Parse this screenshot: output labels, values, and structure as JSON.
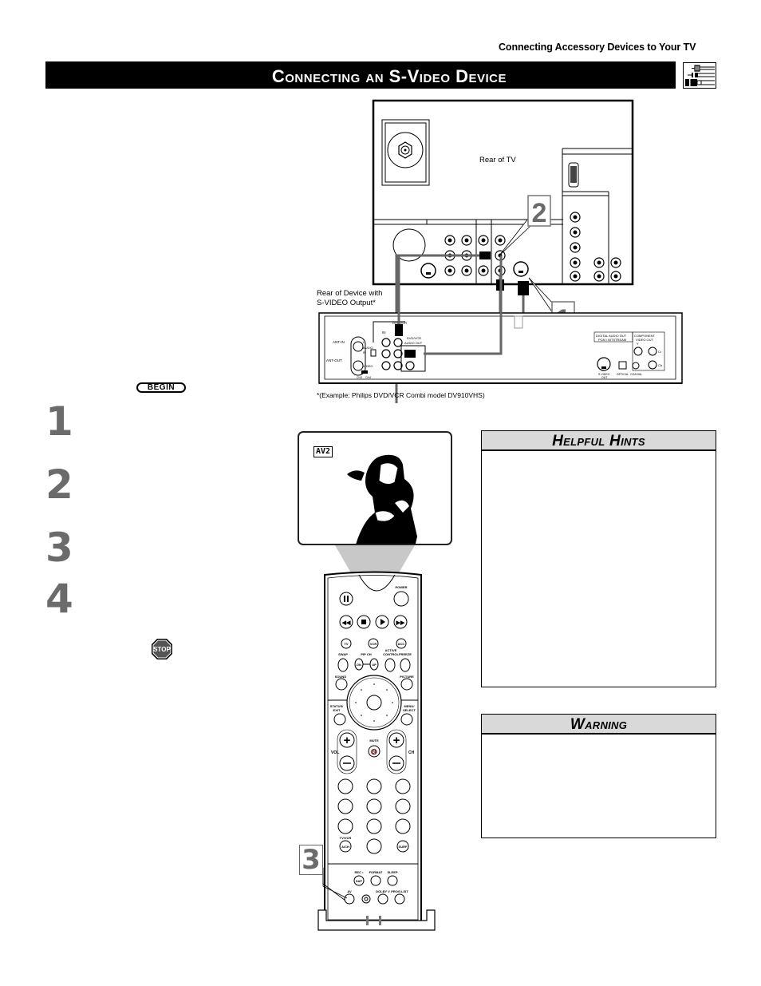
{
  "page": {
    "section_header": "Connecting Accessory Devices to Your TV",
    "title": "Connecting an S-Video Device"
  },
  "icons": {
    "cable_icon": "cable-connectors-icon",
    "begin": "begin-badge",
    "stop": "stop-sign-icon"
  },
  "diagram": {
    "tv_label": "Rear of TV",
    "device_label_line1": "Rear of Device with",
    "device_label_line2": "S-VIDEO Output*",
    "footnote": "*(Example: Philips DVD/VCR Combi model DV910VHS)",
    "callouts": [
      "1",
      "2"
    ],
    "device_ports": {
      "ant_in": "ANT-IN",
      "ant_out": "ANT-OUT",
      "dvd_vcr": "DVD/VCR",
      "in": "IN",
      "audio": "AUDIO",
      "l": "L",
      "r": "R",
      "video": "VIDEO",
      "ch3": "CH3",
      "ch4": "CH4",
      "dvd_vcr_audio_out_1": "DVD/VCR",
      "dvd_vcr_audio_out_2": "AUDIO OUT",
      "digital_audio_out": "DIGITAL AUDIO OUT",
      "pcm_bitstream": "PCM / BITSTREAM",
      "component_video_out_1": "COMPONENT",
      "component_video_out_2": "VIDEO OUT",
      "y": "Y",
      "cr": "Cr",
      "cb": "Cb",
      "s_video_out_1": "S-VIDEO",
      "s_video_out_2": "OUT",
      "optical": "OPTICAL",
      "coaxial": "COAXIAL"
    }
  },
  "begin_label": "BEGIN",
  "steps": [
    "1",
    "2",
    "3",
    "4"
  ],
  "stop_label": "STOP",
  "screen": {
    "channel_label": "AV2"
  },
  "remote": {
    "power": "POWER",
    "tv": "TV",
    "vcr": "VCR",
    "acc": "ACC",
    "swap": "SWAP",
    "pip_ch": "PIP CH",
    "dn": "DN",
    "up": "UP",
    "active_control_1": "ACTIVE",
    "active_control_2": "CONTROL",
    "freeze": "FREEZE",
    "sound": "SOUND",
    "picture": "PICTURE",
    "status_exit_1": "STATUS/",
    "status_exit_2": "EXIT",
    "menu_select_1": "MENU/",
    "menu_select_2": "SELECT",
    "mute": "MUTE",
    "vol": "VOL",
    "ch": "CH",
    "tv_vcr": "TV/VCR",
    "a_ch": "A/CH",
    "surf": "SURF",
    "rec": "REC •",
    "format": "FORMAT",
    "sleep": "SLEEP",
    "sap": "SAP",
    "av": "AV",
    "dolby_v": "DOLBY V",
    "prog_list": "PROG.LIST"
  },
  "callout_3": "3",
  "helpful_hints": {
    "title": "Helpful Hints"
  },
  "warning": {
    "title": "Warning"
  }
}
